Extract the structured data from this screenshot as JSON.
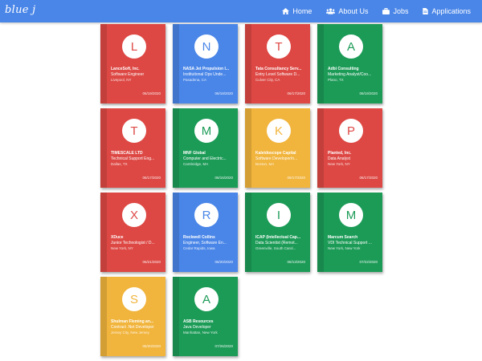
{
  "brand": "blue j",
  "nav": [
    {
      "label": "Home",
      "icon": "home-icon"
    },
    {
      "label": "About Us",
      "icon": "users-icon"
    },
    {
      "label": "Jobs",
      "icon": "briefcase-icon"
    },
    {
      "label": "Applications",
      "icon": "document-icon"
    }
  ],
  "colors": {
    "red": "#dd4844",
    "blue": "#4a86e8",
    "green": "#1c9b57",
    "yellow": "#f1b43c"
  },
  "cards": [
    {
      "letter": "L",
      "company": "LanceSoft, Inc.",
      "role": "Software Engineer",
      "location": "Livepool, NY",
      "date": "06/19/2020",
      "color": "red"
    },
    {
      "letter": "N",
      "company": "NASA Jet Propulsion l...",
      "role": "Institutional Ops Unde...",
      "location": "Pasadena, CA",
      "date": "06/18/2020",
      "color": "blue"
    },
    {
      "letter": "T",
      "company": "Tata Consultancy Serv...",
      "role": "Entry Level Software D...",
      "location": "Culver City, CA",
      "date": "06/17/2020",
      "color": "red"
    },
    {
      "letter": "A",
      "company": "Adbi Consulting",
      "role": "Marketing Analyst/Coo...",
      "location": "Plano, TX",
      "date": "06/19/2020",
      "color": "green"
    },
    {
      "letter": "T",
      "company": "TIMESCALE LTD",
      "role": "Technical Support Eng...",
      "location": "Dallas, TX",
      "date": "06/17/2020",
      "color": "red"
    },
    {
      "letter": "M",
      "company": "MNF Global",
      "role": "Computer and Electric...",
      "location": "Cambridge, MA",
      "date": "06/16/2020",
      "color": "green"
    },
    {
      "letter": "K",
      "company": "Kaleidoscope Capital",
      "role": "Software Developer/n...",
      "location": "Boston, MA",
      "date": "06/17/2020",
      "color": "yellow"
    },
    {
      "letter": "P",
      "company": "Planted, Inc.",
      "role": "Data Analyst",
      "location": "New York, NY",
      "date": "06/17/2020",
      "color": "red"
    },
    {
      "letter": "X",
      "company": "XDuce",
      "role": "Junior Technologist / D...",
      "location": "New York, NY",
      "date": "06/21/2020",
      "color": "red"
    },
    {
      "letter": "R",
      "company": "Rockwell Collins",
      "role": "Engineer, Software En...",
      "location": "Cedar Rapids, Iowa",
      "date": "06/20/2020",
      "color": "blue"
    },
    {
      "letter": "I",
      "company": "ICAP (Intellectual Cap...",
      "role": "Data Scientist (Remot...",
      "location": "Greenville, South Carol...",
      "date": "06/13/2020",
      "color": "green"
    },
    {
      "letter": "M",
      "company": "Marcum Search",
      "role": "VDI Technical Support ...",
      "location": "New York, New York",
      "date": "07/22/2020",
      "color": "green"
    },
    {
      "letter": "S",
      "company": "Shulman Fleming an...",
      "role": "Contract .Net Developer",
      "location": "Jersey City, New Jersey",
      "date": "06/20/2020",
      "color": "yellow"
    },
    {
      "letter": "A",
      "company": "ASB Resources",
      "role": "Java Developer",
      "location": "Manhattan, New York",
      "date": "07/26/2020",
      "color": "green"
    }
  ]
}
